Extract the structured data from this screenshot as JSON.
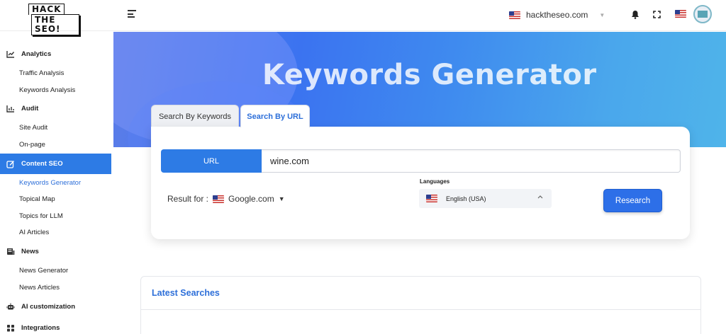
{
  "header": {
    "logo_line1": "HACK",
    "logo_line2": "THE SEO!",
    "site": "hacktheseo.com"
  },
  "sidebar": {
    "sections": [
      {
        "label": "Analytics",
        "items": [
          "Traffic Analysis",
          "Keywords Analysis"
        ]
      },
      {
        "label": "Audit",
        "items": [
          "Site Audit",
          "On-page"
        ]
      },
      {
        "label": "Content SEO",
        "items": [
          "Keywords Generator",
          "Topical Map",
          "Topics for LLM",
          "AI Articles"
        ]
      },
      {
        "label": "News",
        "items": [
          "News Generator",
          "News Articles"
        ]
      },
      {
        "label": "AI customization",
        "items": []
      },
      {
        "label": "Integrations",
        "items": []
      }
    ],
    "active_section": "Content SEO",
    "active_item": "Keywords Generator"
  },
  "hero": {
    "title": "Keywords Generator"
  },
  "tabs": [
    {
      "label": "Search By Keywords",
      "active": false
    },
    {
      "label": "Search By URL",
      "active": true
    }
  ],
  "search": {
    "url_label": "URL",
    "url_value": "wine.com",
    "result_for_label": "Result for :",
    "engine": "Google.com",
    "languages_label": "Languages",
    "language": "English (USA)",
    "research_button": "Research"
  },
  "latest": {
    "title": "Latest Searches"
  },
  "colors": {
    "accent": "#2d7be5",
    "link_active": "#2d6fd9"
  }
}
